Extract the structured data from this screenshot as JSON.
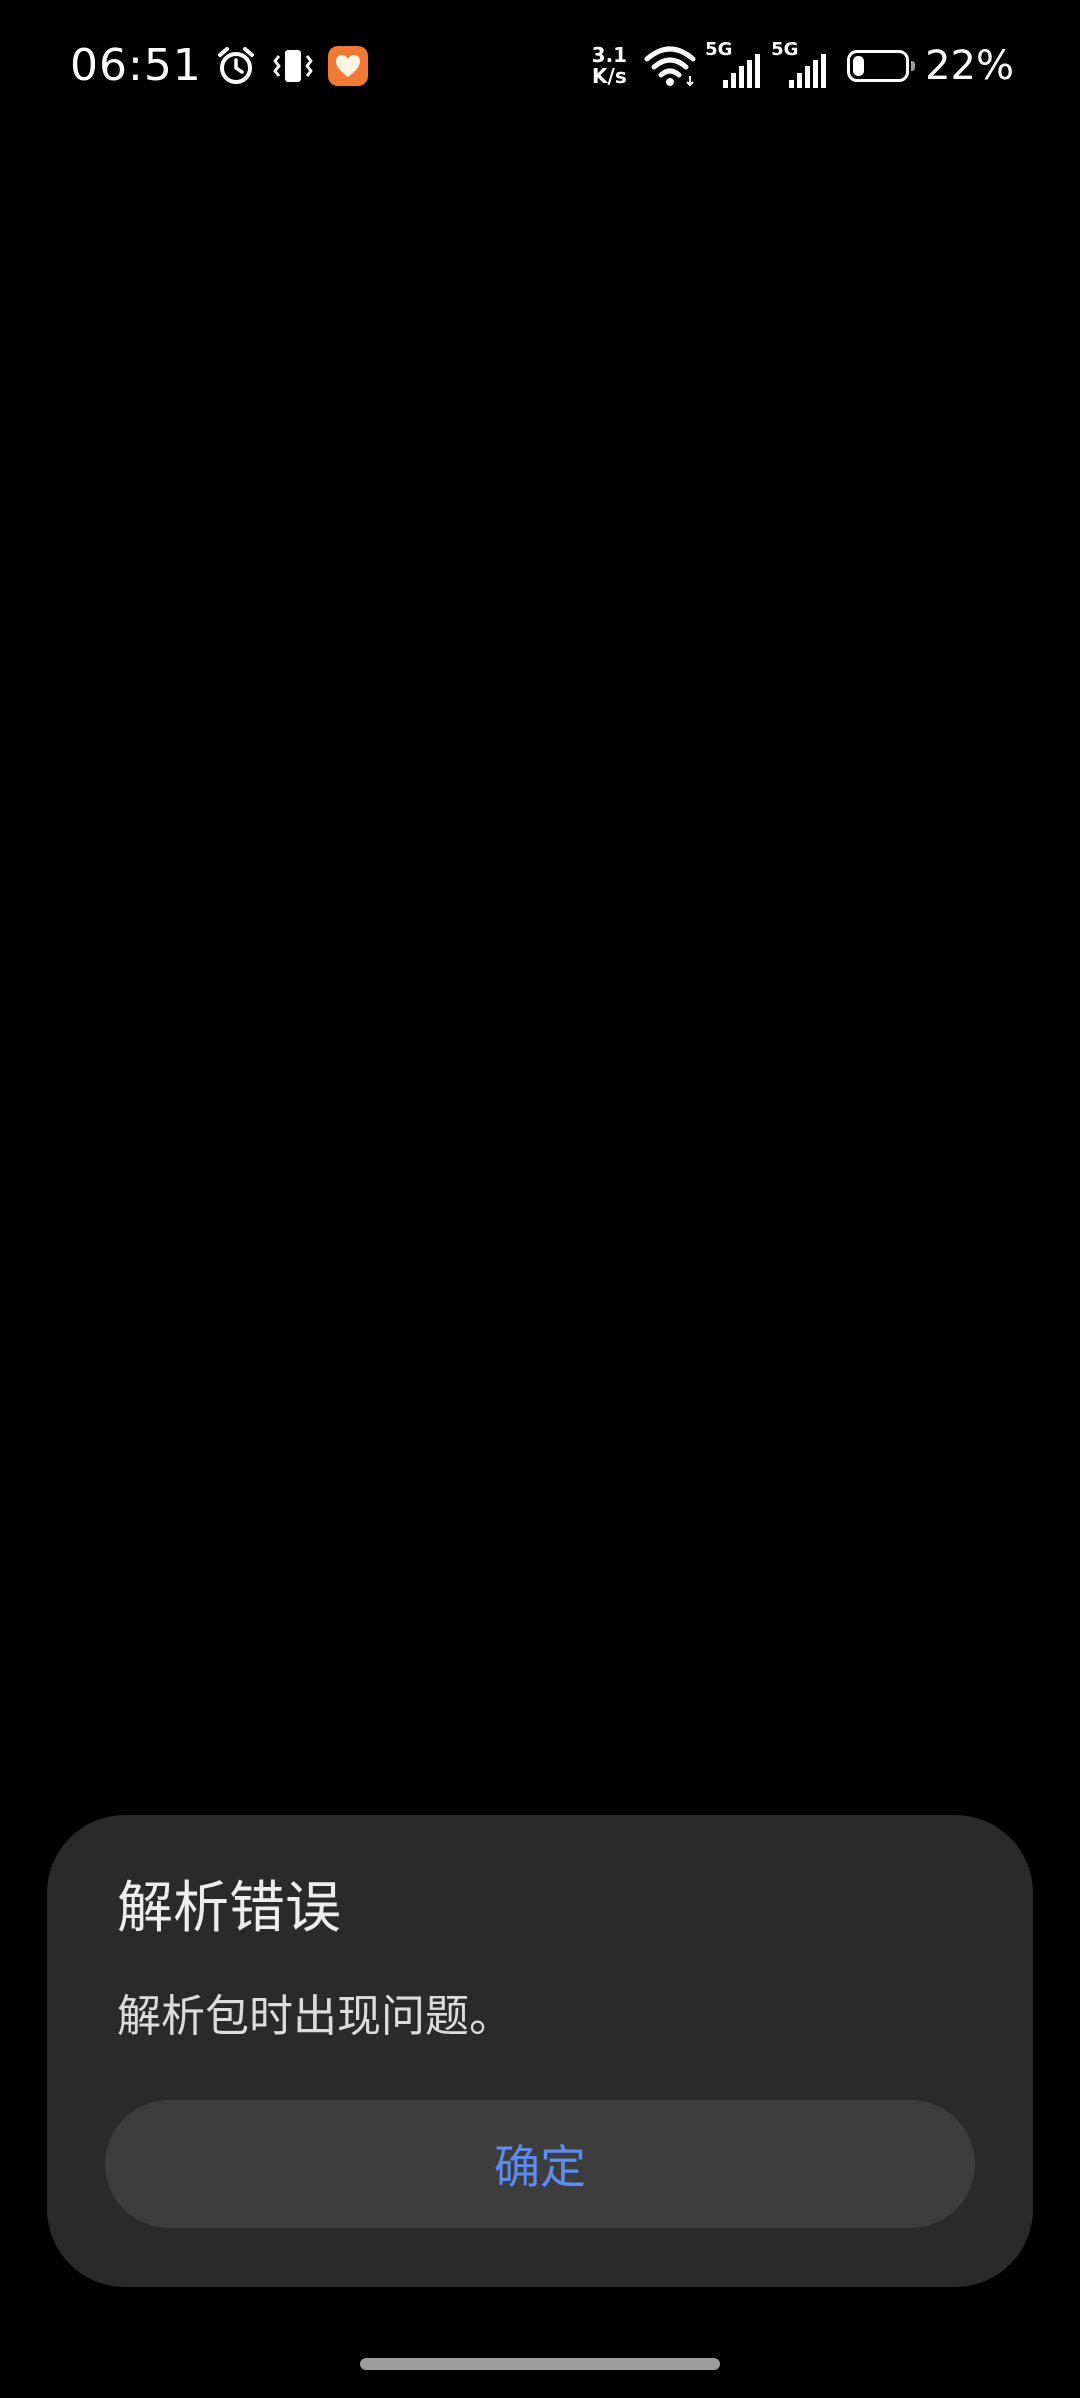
{
  "status_bar": {
    "time": "06:51",
    "net_speed_value": "3.1",
    "net_speed_unit": "K/s",
    "sim1_label": "5G",
    "sim2_label": "5G",
    "battery_percent": "22%",
    "battery_level": 0.22,
    "app_badge_color": "#f07a35",
    "icons": [
      "alarm-icon",
      "vibrate-icon",
      "app-heart-icon",
      "wifi-icon",
      "signal-icon",
      "battery-icon"
    ]
  },
  "dialog": {
    "title": "解析错误",
    "message": "解析包时出现问题。",
    "confirm_label": "确定",
    "accent_color": "#5d8bf0"
  }
}
